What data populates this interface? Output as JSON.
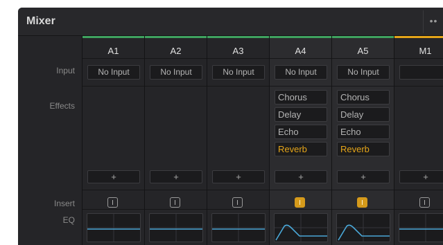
{
  "window": {
    "title": "Mixer"
  },
  "row_labels": {
    "input": "Input",
    "effects": "Effects",
    "insert": "Insert",
    "eq": "EQ"
  },
  "add_label": "+",
  "colors": {
    "green": "#3fa35f",
    "orange": "#e5a519",
    "insert_on": "#d59a1b"
  },
  "channels": [
    {
      "name": "A1",
      "input": "No Input",
      "effects": [],
      "insert_on": false,
      "eq": "flat",
      "color": "green"
    },
    {
      "name": "A2",
      "input": "No Input",
      "effects": [],
      "insert_on": false,
      "eq": "flat",
      "color": "green"
    },
    {
      "name": "A3",
      "input": "No Input",
      "effects": [],
      "insert_on": false,
      "eq": "flat",
      "color": "green"
    },
    {
      "name": "A4",
      "input": "No Input",
      "effects": [
        {
          "label": "Chorus",
          "active": false
        },
        {
          "label": "Delay",
          "active": false
        },
        {
          "label": "Echo",
          "active": false
        },
        {
          "label": "Reverb",
          "active": true
        }
      ],
      "insert_on": true,
      "eq": "curve",
      "color": "green"
    },
    {
      "name": "A5",
      "input": "No Input",
      "effects": [
        {
          "label": "Chorus",
          "active": false
        },
        {
          "label": "Delay",
          "active": false
        },
        {
          "label": "Echo",
          "active": false
        },
        {
          "label": "Reverb",
          "active": true
        }
      ],
      "insert_on": true,
      "eq": "curve",
      "color": "green"
    },
    {
      "name": "M1",
      "input": "",
      "effects": [],
      "insert_on": false,
      "eq": "flat",
      "color": "orange"
    }
  ]
}
